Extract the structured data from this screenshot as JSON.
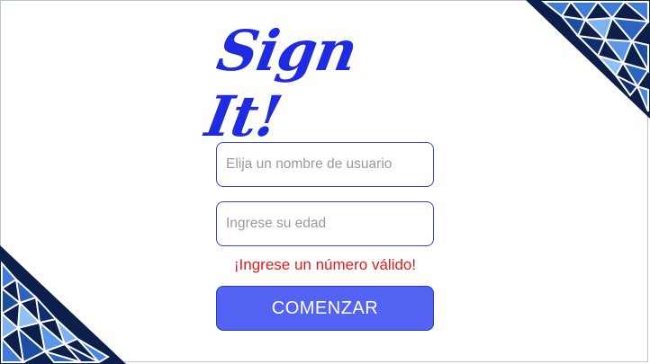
{
  "app": {
    "logo_text": "Sign It!"
  },
  "form": {
    "username_placeholder": "Elija un nombre de usuario",
    "age_placeholder": "Ingrese su edad",
    "error_message": "¡Ingrese un número válido!",
    "submit_label": "COMENZAR"
  },
  "colors": {
    "brand": "#1e2be0",
    "button": "#5364f5",
    "error": "#e11b1b",
    "deco_dark": "#0b1f4a",
    "deco_light": "#4a86e0"
  },
  "decorations": {
    "top_right": "triangle-mosaic",
    "bottom_left": "triangle-mosaic"
  }
}
